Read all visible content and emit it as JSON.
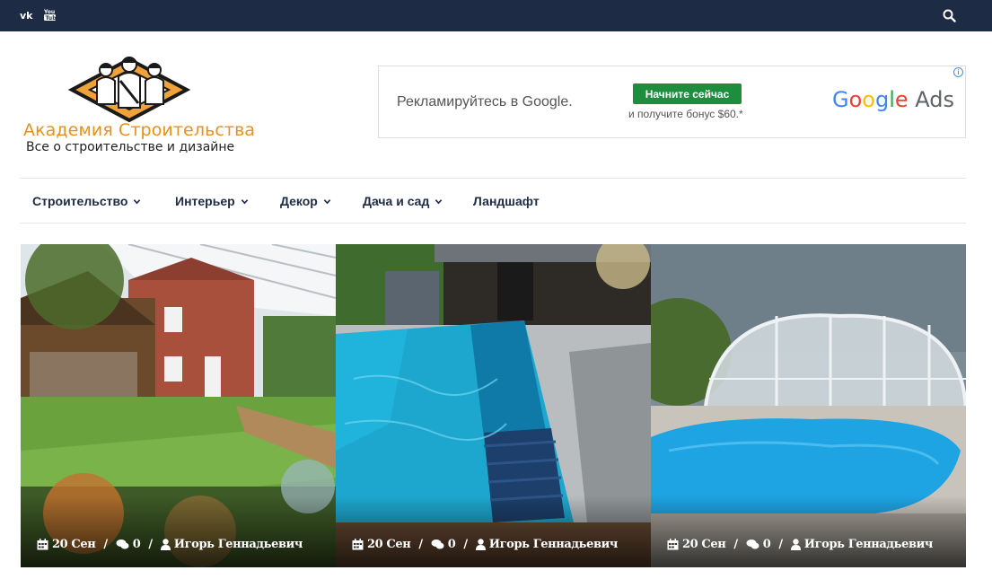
{
  "topbar": {
    "social_icons": [
      "vk-icon",
      "youtube-icon"
    ],
    "search_icon": "search-icon",
    "background": "#1d2b45"
  },
  "logo": {
    "brand": "Академия Строительства",
    "tagline": "Все о строительстве и дизайне",
    "brand_color": "#e8901c"
  },
  "ad": {
    "text": "Рекламируйтесь в Google.",
    "cta": "Начните сейчас",
    "bonus": "и получите бонус $60.*",
    "brand_google": "Google",
    "brand_ads": "Ads",
    "info": "i"
  },
  "nav": {
    "items": [
      {
        "label": "Строительство",
        "has_dropdown": true
      },
      {
        "label": "Интерьер",
        "has_dropdown": true
      },
      {
        "label": "Декор",
        "has_dropdown": true
      },
      {
        "label": "Дача и сад",
        "has_dropdown": true
      },
      {
        "label": "Ландшафт",
        "has_dropdown": false
      }
    ]
  },
  "posts": [
    {
      "date": "20 Сен",
      "comments": "0",
      "author": "Игорь Геннадьевич"
    },
    {
      "date": "20 Сен",
      "comments": "0",
      "author": "Игорь Геннадьевич"
    },
    {
      "date": "20 Сен",
      "comments": "0",
      "author": "Игорь Геннадьевич"
    }
  ],
  "meta_separator": "/"
}
